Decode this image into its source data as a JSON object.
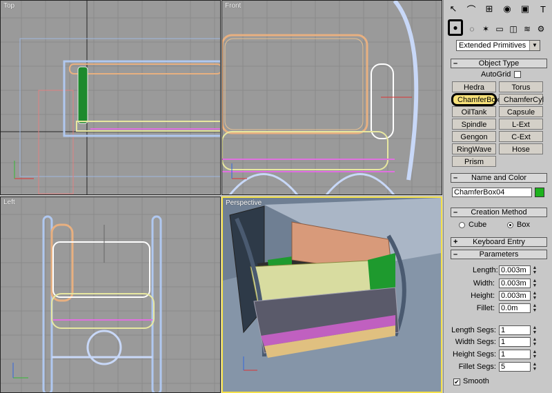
{
  "viewports": {
    "top": {
      "label": "Top"
    },
    "front": {
      "label": "Front"
    },
    "left": {
      "label": "Left"
    },
    "perspective": {
      "label": "Perspective"
    }
  },
  "command_panel": {
    "tab_icons": [
      "pointer-icon",
      "curve-icon",
      "hierarchy-icon",
      "motion-icon",
      "display-icon",
      "utilities-icon"
    ],
    "tab_glyphs": [
      "↖",
      "⌒",
      "⊞",
      "◉",
      "▣",
      "T"
    ],
    "sub_icons": [
      "geometry-icon",
      "shapes-icon",
      "lights-icon",
      "cameras-icon",
      "helpers-icon",
      "spacewarps-icon",
      "systems-icon"
    ],
    "sub_glyphs": [
      "●",
      "◌",
      "✶",
      "▭",
      "◫",
      "≋",
      "⚙"
    ],
    "category": "Extended Primitives",
    "object_type": {
      "title": "Object Type",
      "autogrid": "AutoGrid",
      "buttons": [
        "Hedra",
        "Torus Knot",
        "ChamferBox",
        "ChamferCyl",
        "OilTank",
        "Capsule",
        "Spindle",
        "L-Ext",
        "Gengon",
        "C-Ext",
        "RingWave",
        "Hose",
        "Prism"
      ]
    },
    "name_color": {
      "title": "Name and Color",
      "name": "ChamferBox04",
      "color": "#1db21d"
    },
    "creation_method": {
      "title": "Creation Method",
      "cube": "Cube",
      "box": "Box"
    },
    "keyboard_entry": {
      "title": "Keyboard Entry"
    },
    "parameters": {
      "title": "Parameters",
      "length_label": "Length:",
      "length": "0.003m",
      "width_label": "Width:",
      "width": "0.003m",
      "height_label": "Height:",
      "height": "0.003m",
      "fillet_label": "Fillet:",
      "fillet": "0.0m",
      "length_segs_label": "Length Segs:",
      "length_segs": "1",
      "width_segs_label": "Width Segs:",
      "width_segs": "1",
      "height_segs_label": "Height Segs:",
      "height_segs": "1",
      "fillet_segs_label": "Fillet Segs:",
      "fillet_segs": "5",
      "smooth_label": "Smooth"
    }
  }
}
